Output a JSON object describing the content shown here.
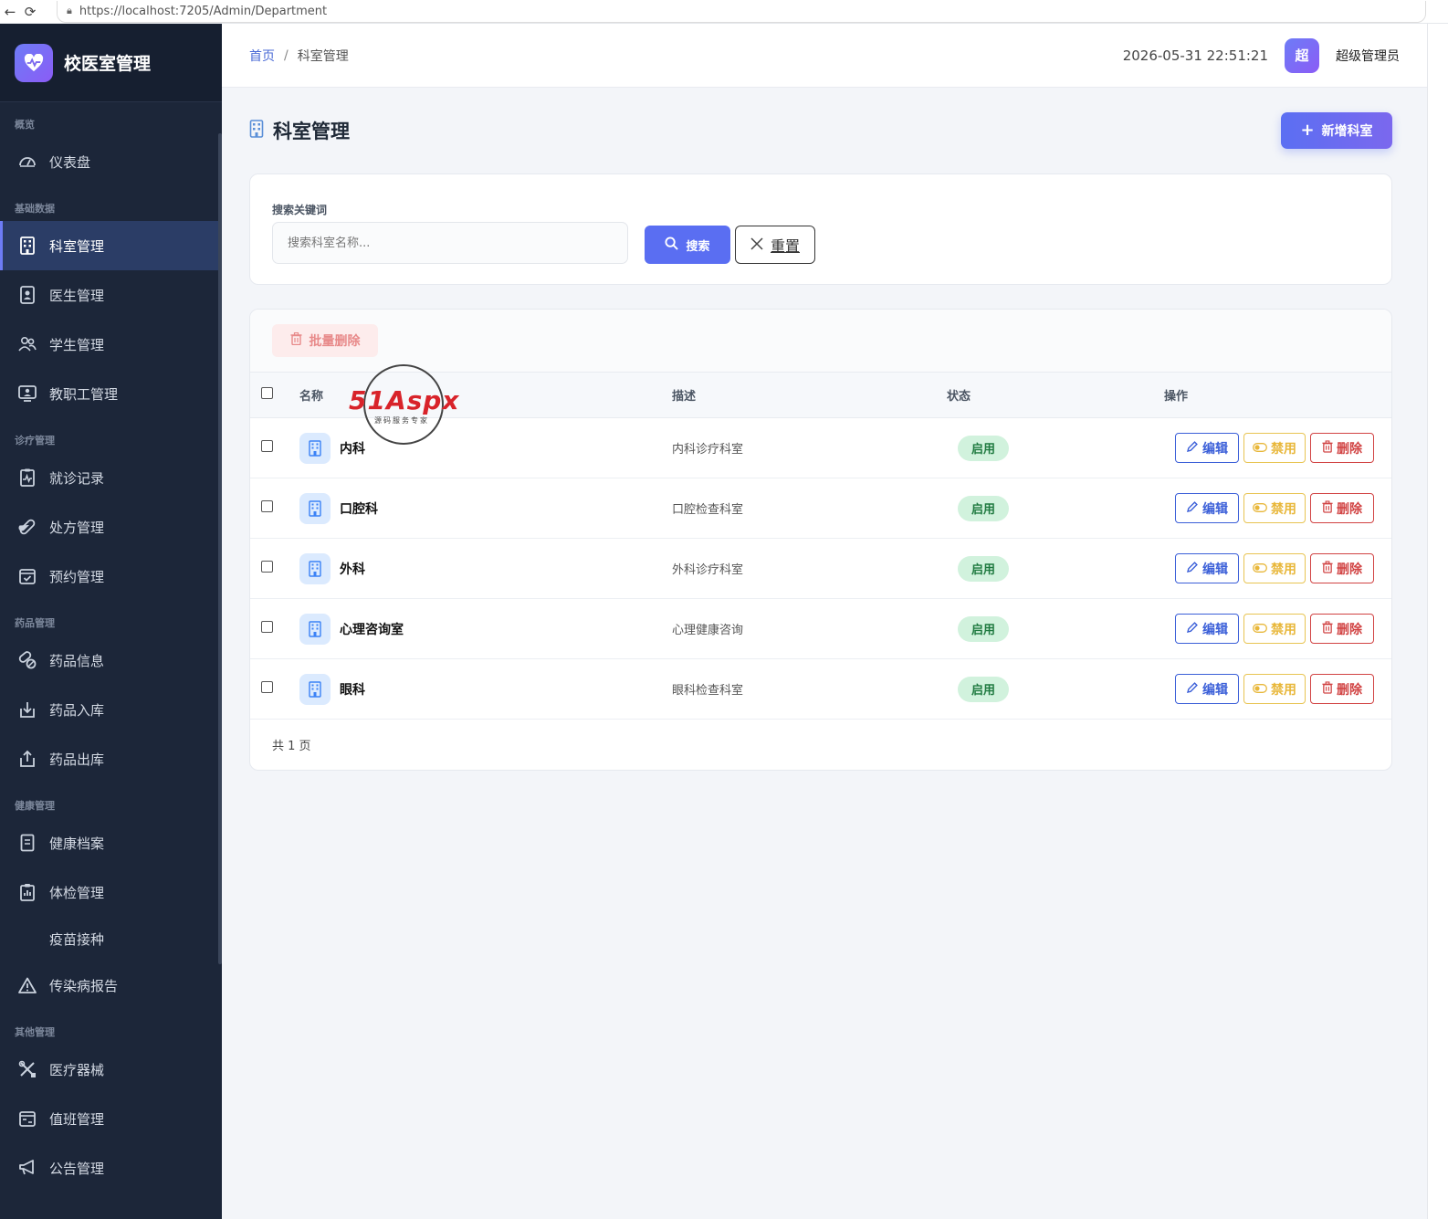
{
  "browser": {
    "url": "https://localhost:7205/Admin/Department"
  },
  "brand": {
    "title": "校医室管理"
  },
  "sidebar": {
    "groups": [
      {
        "label": "概览",
        "items": [
          {
            "label": "仪表盘",
            "icon": "dashboard-icon"
          }
        ]
      },
      {
        "label": "基础数据",
        "items": [
          {
            "label": "科室管理",
            "icon": "building-icon",
            "active": true
          },
          {
            "label": "医生管理",
            "icon": "doctor-badge-icon"
          },
          {
            "label": "学生管理",
            "icon": "users-icon"
          },
          {
            "label": "教职工管理",
            "icon": "staff-icon"
          }
        ]
      },
      {
        "label": "诊疗管理",
        "items": [
          {
            "label": "就诊记录",
            "icon": "medical-record-icon"
          },
          {
            "label": "处方管理",
            "icon": "capsule-icon"
          },
          {
            "label": "预约管理",
            "icon": "calendar-check-icon"
          }
        ]
      },
      {
        "label": "药品管理",
        "items": [
          {
            "label": "药品信息",
            "icon": "pills-icon"
          },
          {
            "label": "药品入库",
            "icon": "inbound-icon"
          },
          {
            "label": "药品出库",
            "icon": "outbound-icon"
          }
        ]
      },
      {
        "label": "健康管理",
        "items": [
          {
            "label": "健康档案",
            "icon": "file-icon"
          },
          {
            "label": "体检管理",
            "icon": "clipboard-icon"
          },
          {
            "label": "疫苗接种",
            "icon": ""
          },
          {
            "label": "传染病报告",
            "icon": "warning-icon"
          }
        ]
      },
      {
        "label": "其他管理",
        "items": [
          {
            "label": "医疗器械",
            "icon": "tools-icon"
          },
          {
            "label": "值班管理",
            "icon": "calendar-icon"
          },
          {
            "label": "公告管理",
            "icon": "megaphone-icon"
          }
        ]
      }
    ]
  },
  "header": {
    "breadcrumb": {
      "home": "首页",
      "separator": "/",
      "current": "科室管理"
    },
    "datetime": "2026-05-31 22:51:21",
    "avatar": "超",
    "username": "超级管理员"
  },
  "page": {
    "title": "科室管理",
    "add_label": "新增科室"
  },
  "search": {
    "label": "搜索关键词",
    "placeholder": "搜索科室名称...",
    "search_label": "搜索",
    "reset_label": "重置"
  },
  "table": {
    "batch_delete_label": "批量删除",
    "columns": {
      "name": "名称",
      "description": "描述",
      "status": "状态",
      "actions": "操作"
    },
    "rows": [
      {
        "name": "内科",
        "description": "内科诊疗科室",
        "status": "启用"
      },
      {
        "name": "口腔科",
        "description": "口腔检查科室",
        "status": "启用"
      },
      {
        "name": "外科",
        "description": "外科诊疗科室",
        "status": "启用"
      },
      {
        "name": "心理咨询室",
        "description": "心理健康咨询",
        "status": "启用"
      },
      {
        "name": "眼科",
        "description": "眼科检查科室",
        "status": "启用"
      }
    ],
    "actions": {
      "edit": "编辑",
      "disable": "禁用",
      "delete": "删除"
    },
    "pagination": "共 1 页"
  },
  "watermark": {
    "brand": "51Aspx",
    "tagline": "源码服务专家"
  },
  "colors": {
    "accent": "#5a6ef2",
    "sidebar": "#1c2639",
    "success": "#1f7a40",
    "danger": "#d14343",
    "warning": "#e8b73a"
  }
}
